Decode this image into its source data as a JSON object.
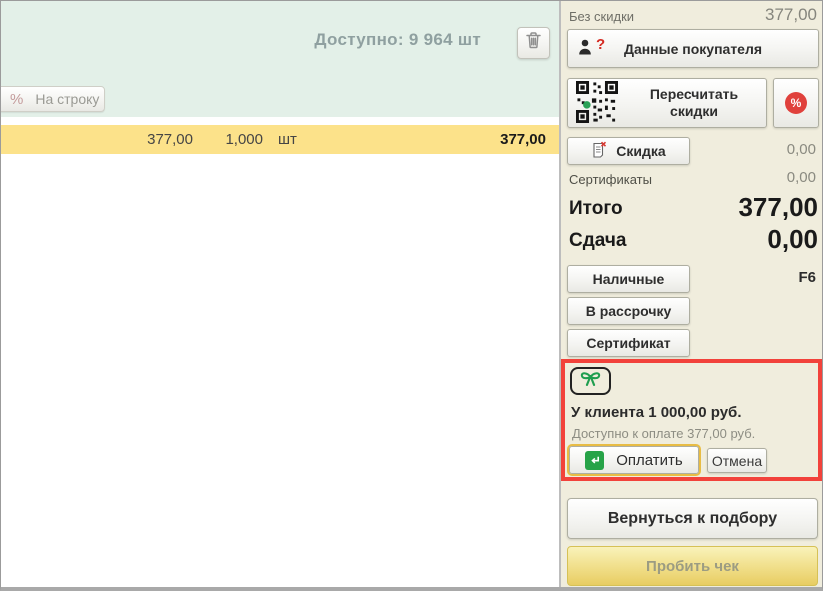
{
  "colors": {
    "green_bg": "#e3f0e8",
    "yellow_row": "#fce28a",
    "panel_bg": "#f0eddd",
    "alert_border": "#f2423b",
    "checkout_yellow": "#e8cd62",
    "pay_highlight_ring": "#e8bc44",
    "icon_green": "#1f9e4f",
    "icon_red_circle": "#e0413c"
  },
  "left": {
    "available_text": "Доступно: 9 964 шт",
    "per_line_button": {
      "percent": "%",
      "label": "На строку"
    },
    "item_row": {
      "price": "377,00",
      "quantity": "1,000",
      "unit": "шт",
      "total": "377,00"
    }
  },
  "summary": {
    "no_discount_label": "Без скидки",
    "no_discount_value": "377,00",
    "customer_button_label": "Данные покупателя",
    "customer_icon_question": "?",
    "recalc_button_label": "Пересчитать скидки",
    "percent_icon": "%",
    "discount_button_label": "Скидка",
    "discount_value": "0,00",
    "certificates_label": "Сертификаты",
    "certificates_value": "0,00",
    "total_label": "Итого",
    "total_value": "377,00",
    "change_label": "Сдача",
    "change_value": "0,00"
  },
  "payments": {
    "cash_button_label": "Наличные",
    "cash_hotkey": "F6",
    "installment_button_label": "В рассрочку",
    "certificate_button_label": "Сертификат"
  },
  "gift_card_panel": {
    "client_balance_text": "У клиента 1 000,00 руб.",
    "available_to_pay_text": "Доступно к оплате 377,00 руб.",
    "pay_button_label": "Оплатить",
    "cancel_button_label": "Отмена"
  },
  "footer": {
    "back_button_label": "Вернуться к подбору",
    "checkout_button_label": "Пробить чек"
  }
}
